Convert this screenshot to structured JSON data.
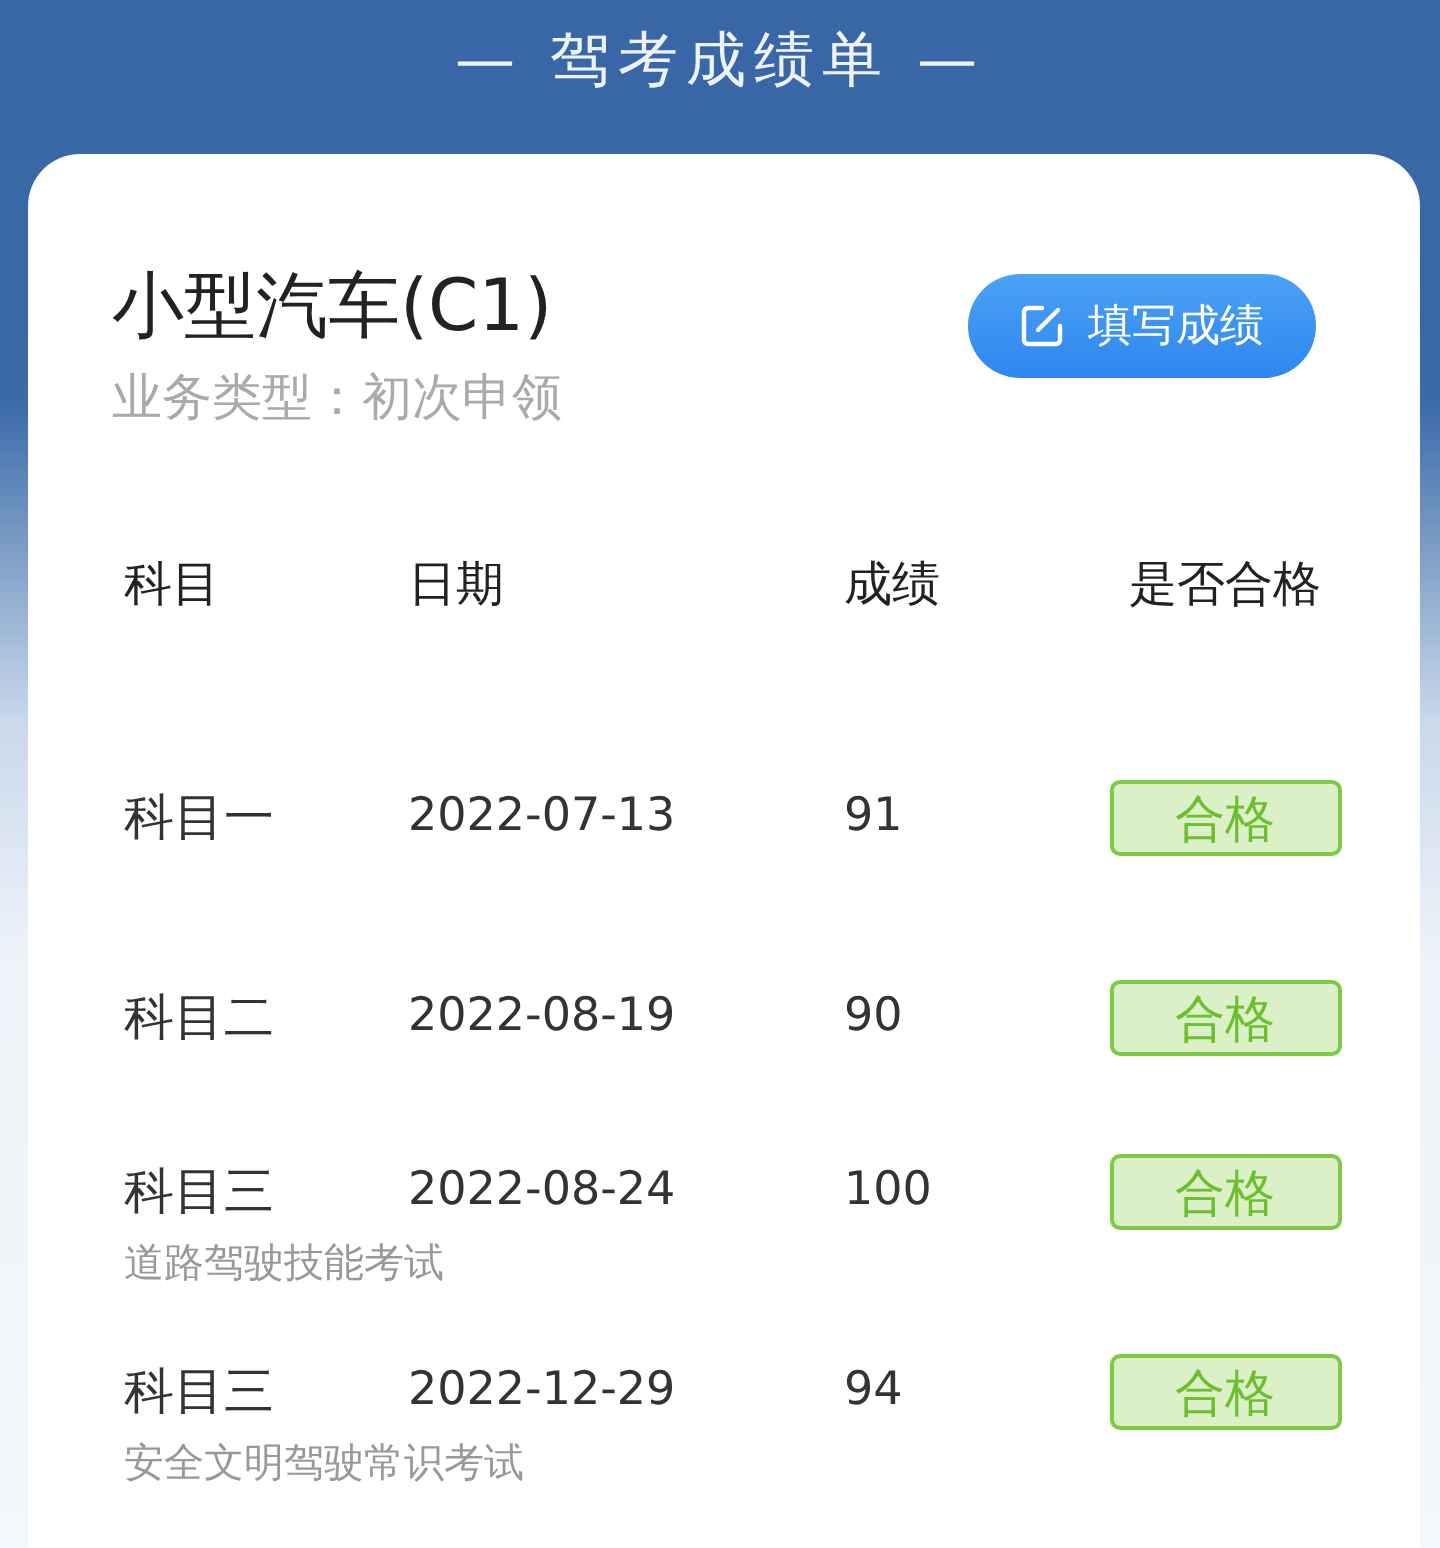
{
  "header": {
    "title": "— 驾考成绩单 —"
  },
  "card": {
    "title": "小型汽车(C1)",
    "subtitle": "业务类型：初次申领",
    "button": "填写成绩"
  },
  "table": {
    "columns": [
      "科目",
      "日期",
      "成绩",
      "是否合格"
    ],
    "rows": [
      {
        "subject": "科目一",
        "date": "2022-07-13",
        "score": "91",
        "result": {
          "text": "合格",
          "kind": "pass"
        }
      },
      {
        "subject": "科目二",
        "date": "2022-08-19",
        "score": "90",
        "result": {
          "text": "合格",
          "kind": "pass"
        }
      },
      {
        "subject": "科目三",
        "note": "道路驾驶技能考试",
        "date": "2022-08-24",
        "score": "100",
        "result": {
          "text": "合格",
          "kind": "pass"
        }
      },
      {
        "subject": "科目三",
        "note": "安全文明驾驶常识考试",
        "date": "2022-12-29",
        "score": "94",
        "result": {
          "text": "合格",
          "kind": "pass"
        }
      }
    ]
  }
}
